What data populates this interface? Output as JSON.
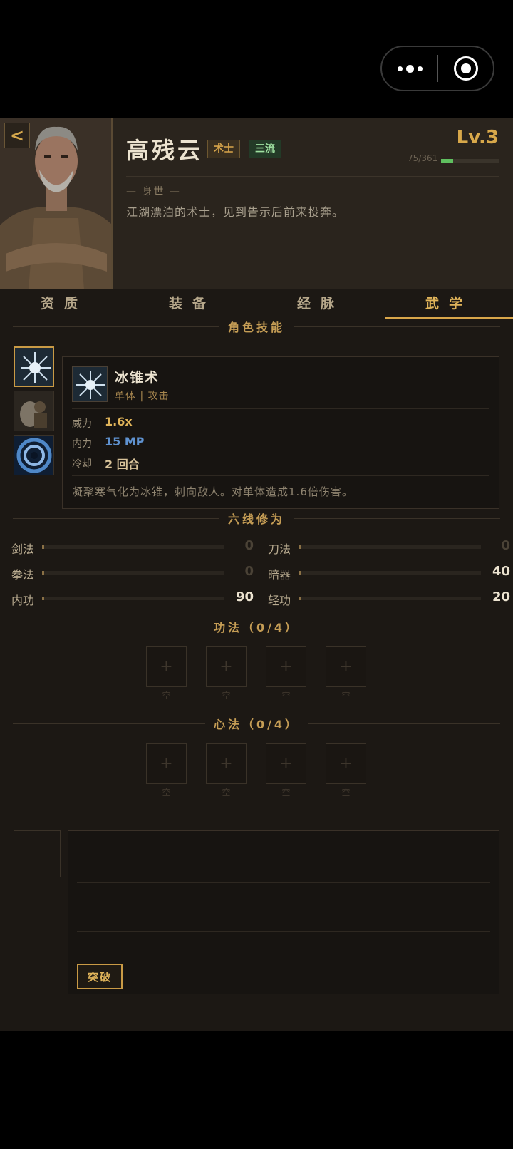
{
  "capsule": {
    "more_icon": "more-dots-icon",
    "close_icon": "target-circle-icon"
  },
  "header": {
    "back_label": "<",
    "name": "高残云",
    "tags": [
      "术士",
      "三流"
    ],
    "level": "Lv.3",
    "exp_text": "75/361",
    "exp_progress": 0.21,
    "bio_title": "— 身世 —",
    "bio_text": "江湖漂泊的术士，见到告示后前来投奔。"
  },
  "tabs": [
    "资质",
    "装备",
    "经脉",
    "武学"
  ],
  "active_tab": "武学",
  "skills": {
    "title": "角色技能",
    "selected": {
      "name": "冰锥术",
      "type": "单体 | 攻击",
      "power_label": "威力",
      "power_value": "1.6x",
      "mp_label": "内力",
      "mp_value": "15 MP",
      "cd_label": "冷却",
      "cd_value": "2 回合",
      "description": "凝聚寒气化为冰锥，刺向敌人。对单体造成1.6倍伤害。"
    }
  },
  "cultivation": {
    "title": "六线修为",
    "attrs": [
      {
        "label": "剑法",
        "value": "0",
        "progress": 0.0
      },
      {
        "label": "刀法",
        "value": "0",
        "progress": 0.0
      },
      {
        "label": "拳法",
        "value": "0",
        "progress": 0.0
      },
      {
        "label": "暗器",
        "value": "40",
        "progress": 0.01
      },
      {
        "label": "内功",
        "value": "90",
        "progress": 0.01
      },
      {
        "label": "轻功",
        "value": "20",
        "progress": 0.01
      }
    ]
  },
  "gongfa": {
    "title": "功法（0/4）",
    "slot_symbol": "+",
    "slot_label": "空"
  },
  "xinfa": {
    "title": "心法（0/4）",
    "slot_symbol": "+",
    "slot_label": "空"
  },
  "breakthrough": {
    "button_label": "突破"
  },
  "colors": {
    "gold": "#d8a84a",
    "green": "#5fbf5f",
    "blue": "#5f92d0",
    "panel": "#1c1814"
  }
}
